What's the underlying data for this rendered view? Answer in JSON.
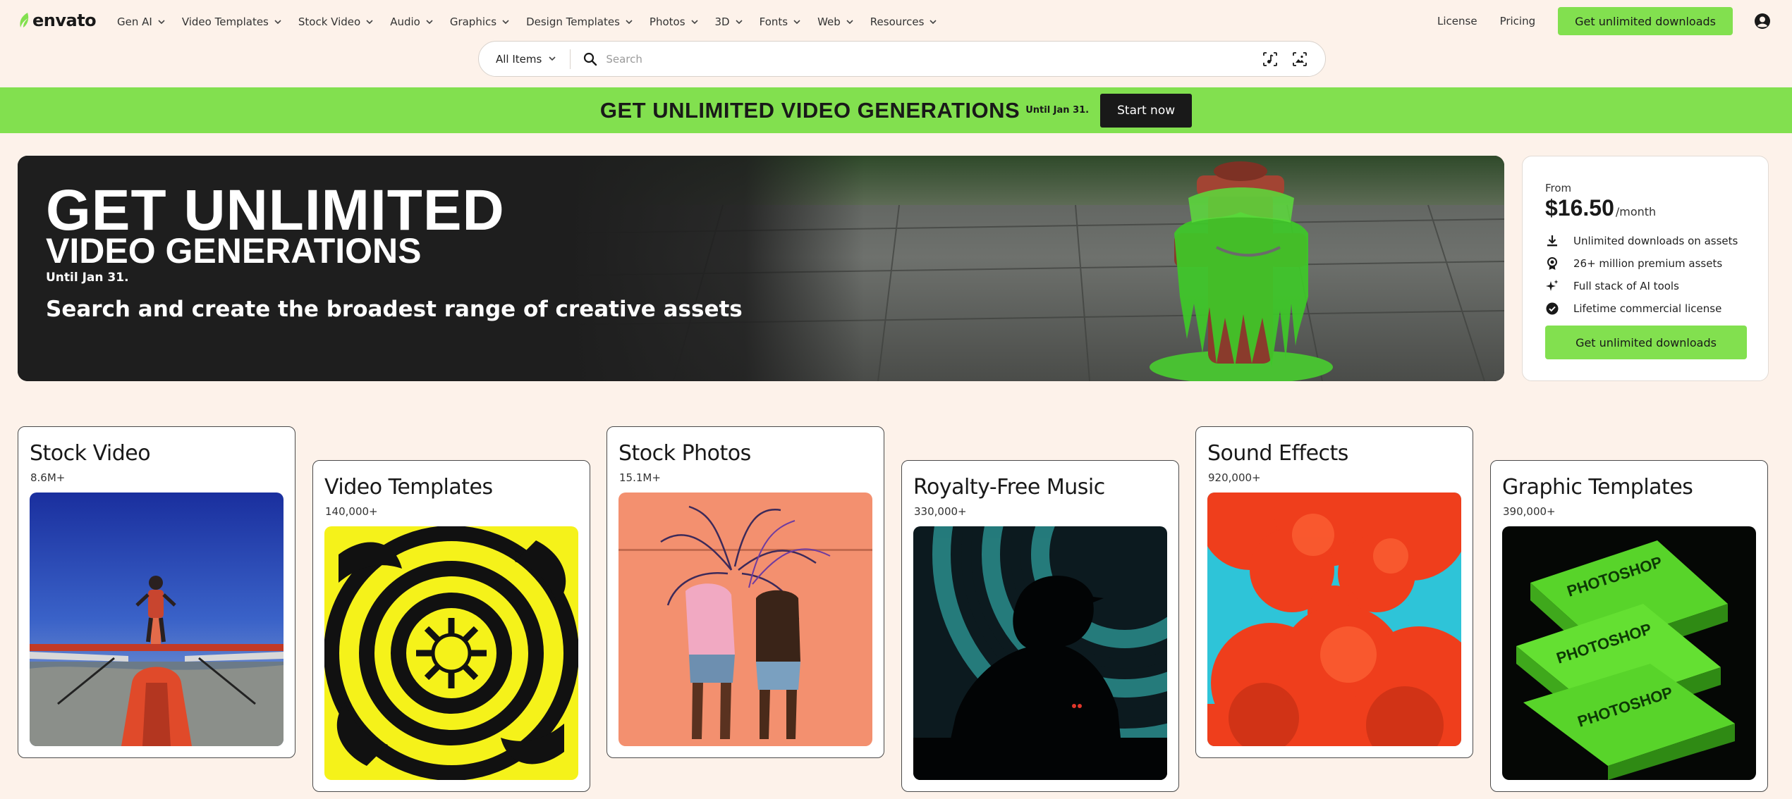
{
  "header": {
    "logo_text": "envato",
    "nav": [
      {
        "label": "Gen AI",
        "icon": "chevron-down-icon"
      },
      {
        "label": "Video Templates",
        "icon": "chevron-down-icon"
      },
      {
        "label": "Stock Video",
        "icon": "chevron-down-icon"
      },
      {
        "label": "Audio",
        "icon": "chevron-down-icon"
      },
      {
        "label": "Graphics",
        "icon": "chevron-down-icon"
      },
      {
        "label": "Design Templates",
        "icon": "chevron-down-icon"
      },
      {
        "label": "Photos",
        "icon": "chevron-down-icon"
      },
      {
        "label": "3D",
        "icon": "chevron-down-icon"
      },
      {
        "label": "Fonts",
        "icon": "chevron-down-icon"
      },
      {
        "label": "Web",
        "icon": "chevron-down-icon"
      },
      {
        "label": "Resources",
        "icon": "chevron-down-icon"
      }
    ],
    "license": "License",
    "pricing": "Pricing",
    "cta": "Get unlimited downloads",
    "user_icon": "user-account-icon"
  },
  "search": {
    "category": "All Items",
    "placeholder": "Search",
    "value": "",
    "tools": [
      "audio-search-icon",
      "image-search-icon"
    ]
  },
  "promo": {
    "title": "GET UNLIMITED VIDEO GENERATIONS",
    "until": "Until Jan 31.",
    "button": "Start now"
  },
  "hero": {
    "line1": "GET UNLIMITED",
    "line2": "VIDEO GENERATIONS",
    "until": "Until Jan 31.",
    "subtitle": "Search and create the broadest range of creative assets"
  },
  "pricing": {
    "from": "From",
    "amount": "$16.50",
    "period": "/month",
    "features": [
      {
        "icon": "download-icon",
        "text": "Unlimited downloads on assets"
      },
      {
        "icon": "premium-badge-icon",
        "text": "26+ million premium assets"
      },
      {
        "icon": "sparkle-icon",
        "text": "Full stack of AI tools"
      },
      {
        "icon": "check-circle-icon",
        "text": "Lifetime commercial license"
      }
    ],
    "cta": "Get unlimited downloads"
  },
  "categories": [
    {
      "title": "Stock Video",
      "count": "8.6M+"
    },
    {
      "title": "Video Templates",
      "count": "140,000+"
    },
    {
      "title": "Stock Photos",
      "count": "15.1M+"
    },
    {
      "title": "Royalty-Free Music",
      "count": "330,000+"
    },
    {
      "title": "Sound Effects",
      "count": "920,000+"
    },
    {
      "title": "Graphic Templates",
      "count": "390,000+"
    }
  ],
  "colors": {
    "accent": "#82e04f",
    "background": "#fdf2ea",
    "dark": "#191919"
  }
}
